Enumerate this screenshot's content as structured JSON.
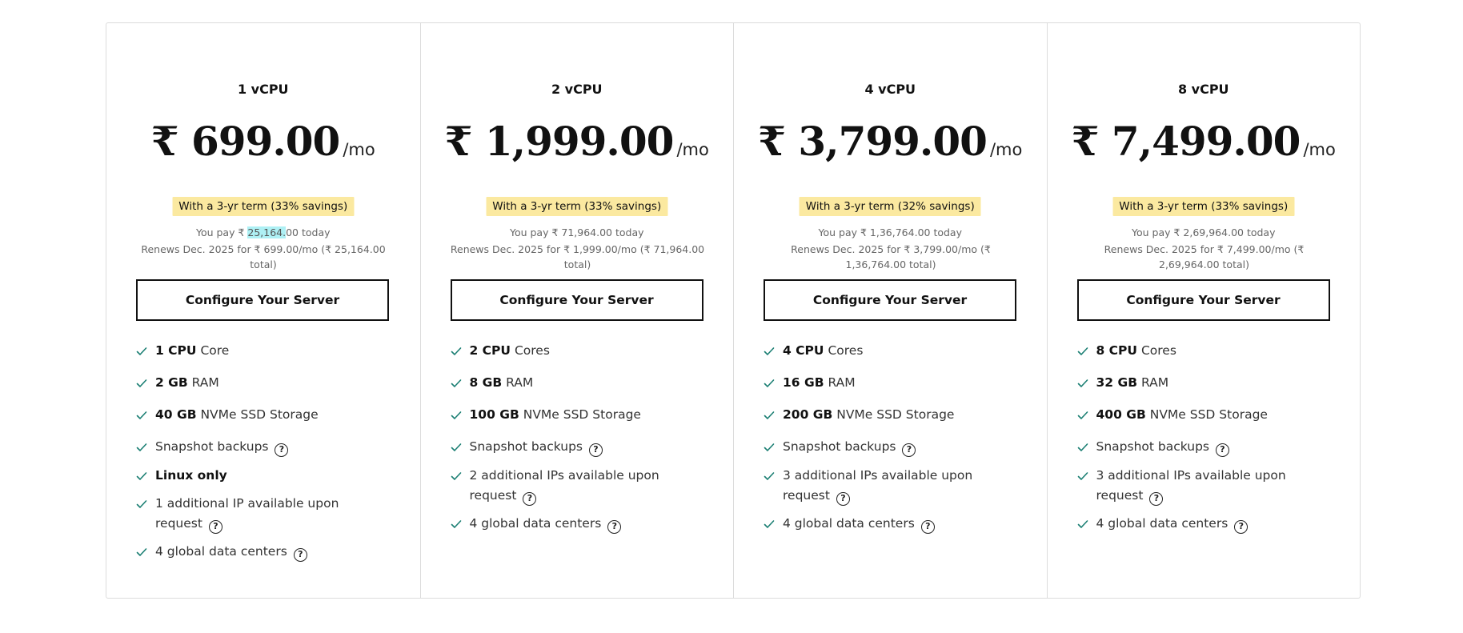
{
  "plans": [
    {
      "name": "1 vCPU",
      "price": "₹ 699.00",
      "per": "/mo",
      "term": "With a 3-yr term (33% savings)",
      "pay_prefix": "You pay ₹ ",
      "pay_highlight": "25,164.",
      "pay_suffix": "00 today",
      "renews": "Renews Dec. 2025 for ₹ 699.00/mo (₹ 25,164.00 total)",
      "button": "Configure Your Server",
      "features": [
        {
          "bold": "1 CPU",
          "text": " Core"
        },
        {
          "bold": "2 GB",
          "text": " RAM"
        },
        {
          "bold": "40 GB",
          "text": " NVMe SSD Storage"
        },
        {
          "bold": "",
          "text": "Snapshot backups",
          "help": true
        },
        {
          "bold": "Linux only",
          "text": ""
        },
        {
          "bold": "",
          "text": "1 additional IP available upon request",
          "help": true
        },
        {
          "bold": "",
          "text": "4 global data centers",
          "help": true
        }
      ]
    },
    {
      "name": "2 vCPU",
      "price": "₹ 1,999.00",
      "per": "/mo",
      "term": "With a 3-yr term (33% savings)",
      "pay_prefix": "You pay ₹ 71,964.00 today",
      "pay_highlight": "",
      "pay_suffix": "",
      "renews": "Renews Dec. 2025 for ₹ 1,999.00/mo (₹ 71,964.00 total)",
      "button": "Configure Your Server",
      "features": [
        {
          "bold": "2 CPU",
          "text": " Cores"
        },
        {
          "bold": "8 GB",
          "text": " RAM"
        },
        {
          "bold": "100 GB",
          "text": " NVMe SSD Storage"
        },
        {
          "bold": "",
          "text": "Snapshot backups",
          "help": true
        },
        {
          "bold": "",
          "text": "2 additional IPs available upon request",
          "help": true
        },
        {
          "bold": "",
          "text": "4 global data centers",
          "help": true
        }
      ]
    },
    {
      "name": "4 vCPU",
      "price": "₹ 3,799.00",
      "per": "/mo",
      "term": "With a 3-yr term (32% savings)",
      "pay_prefix": "You pay ₹ 1,36,764.00 today",
      "pay_highlight": "",
      "pay_suffix": "",
      "renews": "Renews Dec. 2025 for ₹ 3,799.00/mo (₹ 1,36,764.00 total)",
      "button": "Configure Your Server",
      "features": [
        {
          "bold": "4 CPU",
          "text": " Cores"
        },
        {
          "bold": "16 GB",
          "text": " RAM"
        },
        {
          "bold": "200 GB",
          "text": " NVMe SSD Storage"
        },
        {
          "bold": "",
          "text": "Snapshot backups",
          "help": true
        },
        {
          "bold": "",
          "text": "3 additional IPs available upon request",
          "help": true
        },
        {
          "bold": "",
          "text": "4 global data centers",
          "help": true
        }
      ]
    },
    {
      "name": "8 vCPU",
      "price": "₹ 7,499.00",
      "per": "/mo",
      "term": "With a 3-yr term (33% savings)",
      "pay_prefix": "You pay ₹ 2,69,964.00 today",
      "pay_highlight": "",
      "pay_suffix": "",
      "renews": "Renews Dec. 2025 for ₹ 7,499.00/mo (₹ 2,69,964.00 total)",
      "button": "Configure Your Server",
      "features": [
        {
          "bold": "8 CPU",
          "text": " Cores"
        },
        {
          "bold": "32 GB",
          "text": " RAM"
        },
        {
          "bold": "400 GB",
          "text": " NVMe SSD Storage"
        },
        {
          "bold": "",
          "text": "Snapshot backups",
          "help": true
        },
        {
          "bold": "",
          "text": "3 additional IPs available upon request",
          "help": true
        },
        {
          "bold": "",
          "text": "4 global data centers",
          "help": true
        }
      ]
    }
  ],
  "icons": {
    "check": "check-icon",
    "help": "question-circle-icon",
    "help_glyph": "?"
  },
  "colors": {
    "check": "#1b7f73",
    "badge_bg": "#fbe9a0",
    "highlight_bg": "#aef0f4",
    "border": "#dcdcdc"
  }
}
